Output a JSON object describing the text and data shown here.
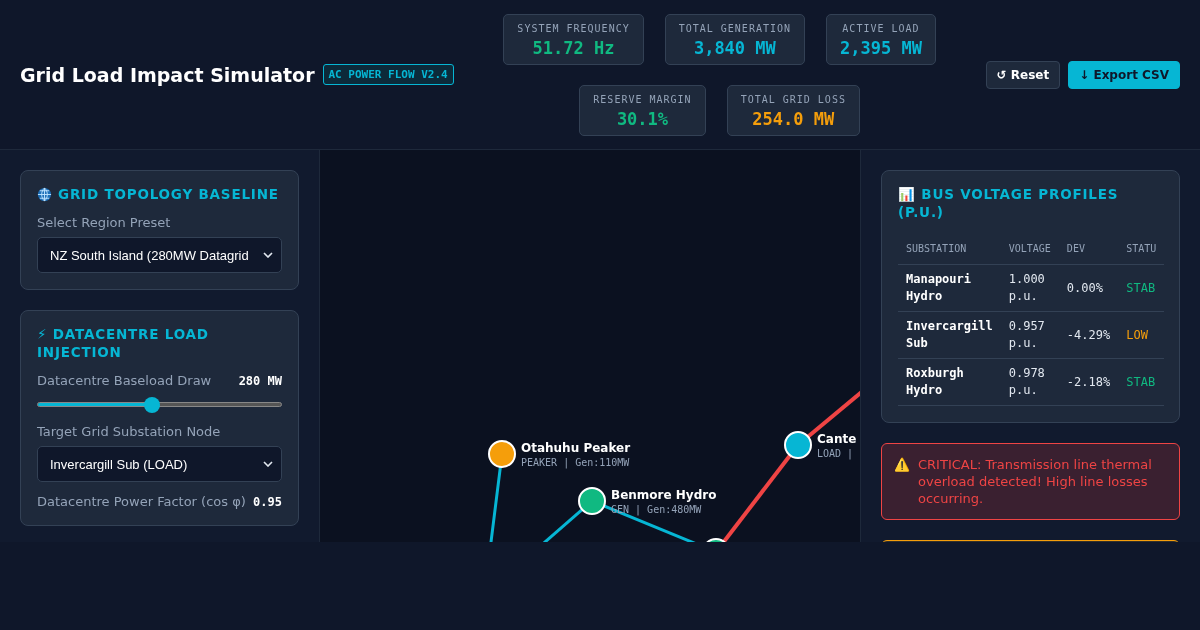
{
  "header": {
    "title": "Grid Load Impact Simulator",
    "badge": "AC POWER FLOW V2.4"
  },
  "stats": [
    {
      "label": "SYSTEM FREQUENCY",
      "value": "51.72 Hz",
      "color": "#10b981"
    },
    {
      "label": "TOTAL GENERATION",
      "value": "3,840 MW",
      "color": "#06b6d4"
    },
    {
      "label": "ACTIVE LOAD",
      "value": "2,395 MW",
      "color": "#06b6d4"
    },
    {
      "label": "RESERVE MARGIN",
      "value": "30.1%",
      "color": "#10b981"
    },
    {
      "label": "TOTAL GRID LOSS",
      "value": "254.0 MW",
      "color": "#f59e0b"
    }
  ],
  "buttons": [
    {
      "icon": "↺",
      "label": "Reset",
      "kind": "secondary"
    },
    {
      "icon": "↓",
      "label": "Export CSV",
      "kind": "primary"
    }
  ],
  "topology": {
    "title": "GRID TOPOLOGY BASELINE",
    "preset_label": "Select Region Preset",
    "preset_value": "NZ South Island (280MW Datagrid"
  },
  "injection": {
    "icon": "⚡",
    "title": "DATACENTRE LOAD INJECTION",
    "draw_label": "Datacentre Baseload Draw",
    "draw_value": "280 MW",
    "draw": {
      "level": 0.47
    },
    "node_label": "Target Grid Substation Node",
    "node_value": "Invercargill Sub (LOAD)",
    "pf_label": "Datacentre Power Factor (cos φ)",
    "pf_value": "0.95"
  },
  "network": {
    "nodes": [
      {
        "name": "Otahuhu Peaker",
        "info": "PEAKER | Gen:110MW",
        "color": "#f59e0b"
      },
      {
        "name": "Benmore Hydro",
        "info": "GEN | Gen:480MW",
        "color": "#10b981"
      },
      {
        "name": "Cante",
        "info": "LOAD |",
        "color": "#06b6d4"
      },
      {
        "color": "#10b981"
      }
    ],
    "lines": [
      {
        "overloaded": false
      },
      {
        "overloaded": false
      },
      {
        "overloaded": false
      },
      {
        "overloaded": true
      },
      {
        "overloaded": true
      }
    ]
  },
  "voltages": {
    "icon": "📊",
    "title": "BUS VOLTAGE PROFILES (P.U.)",
    "columns": [
      "SUBSTATION",
      "VOLTAGE",
      "DEV",
      "STATU"
    ],
    "rows": [
      {
        "substation": "Manapouri Hydro",
        "voltage": "1.000 p.u.",
        "dev": "0.00%",
        "status": "STAB",
        "color": "#10b981"
      },
      {
        "substation": "Invercargill Sub",
        "voltage": "0.957 p.u.",
        "dev": "-4.29%",
        "status": "LOW",
        "color": "#f59e0b"
      },
      {
        "substation": "Roxburgh Hydro",
        "voltage": "0.978 p.u.",
        "dev": "-2.18%",
        "status": "STAB",
        "color": "#10b981"
      }
    ]
  },
  "alerts": [
    {
      "kind": "critical",
      "icon": "⚠️",
      "message": "CRITICAL: Transmission line thermal overload detected! High line losses occurring."
    },
    {
      "kind": "warning"
    }
  ]
}
